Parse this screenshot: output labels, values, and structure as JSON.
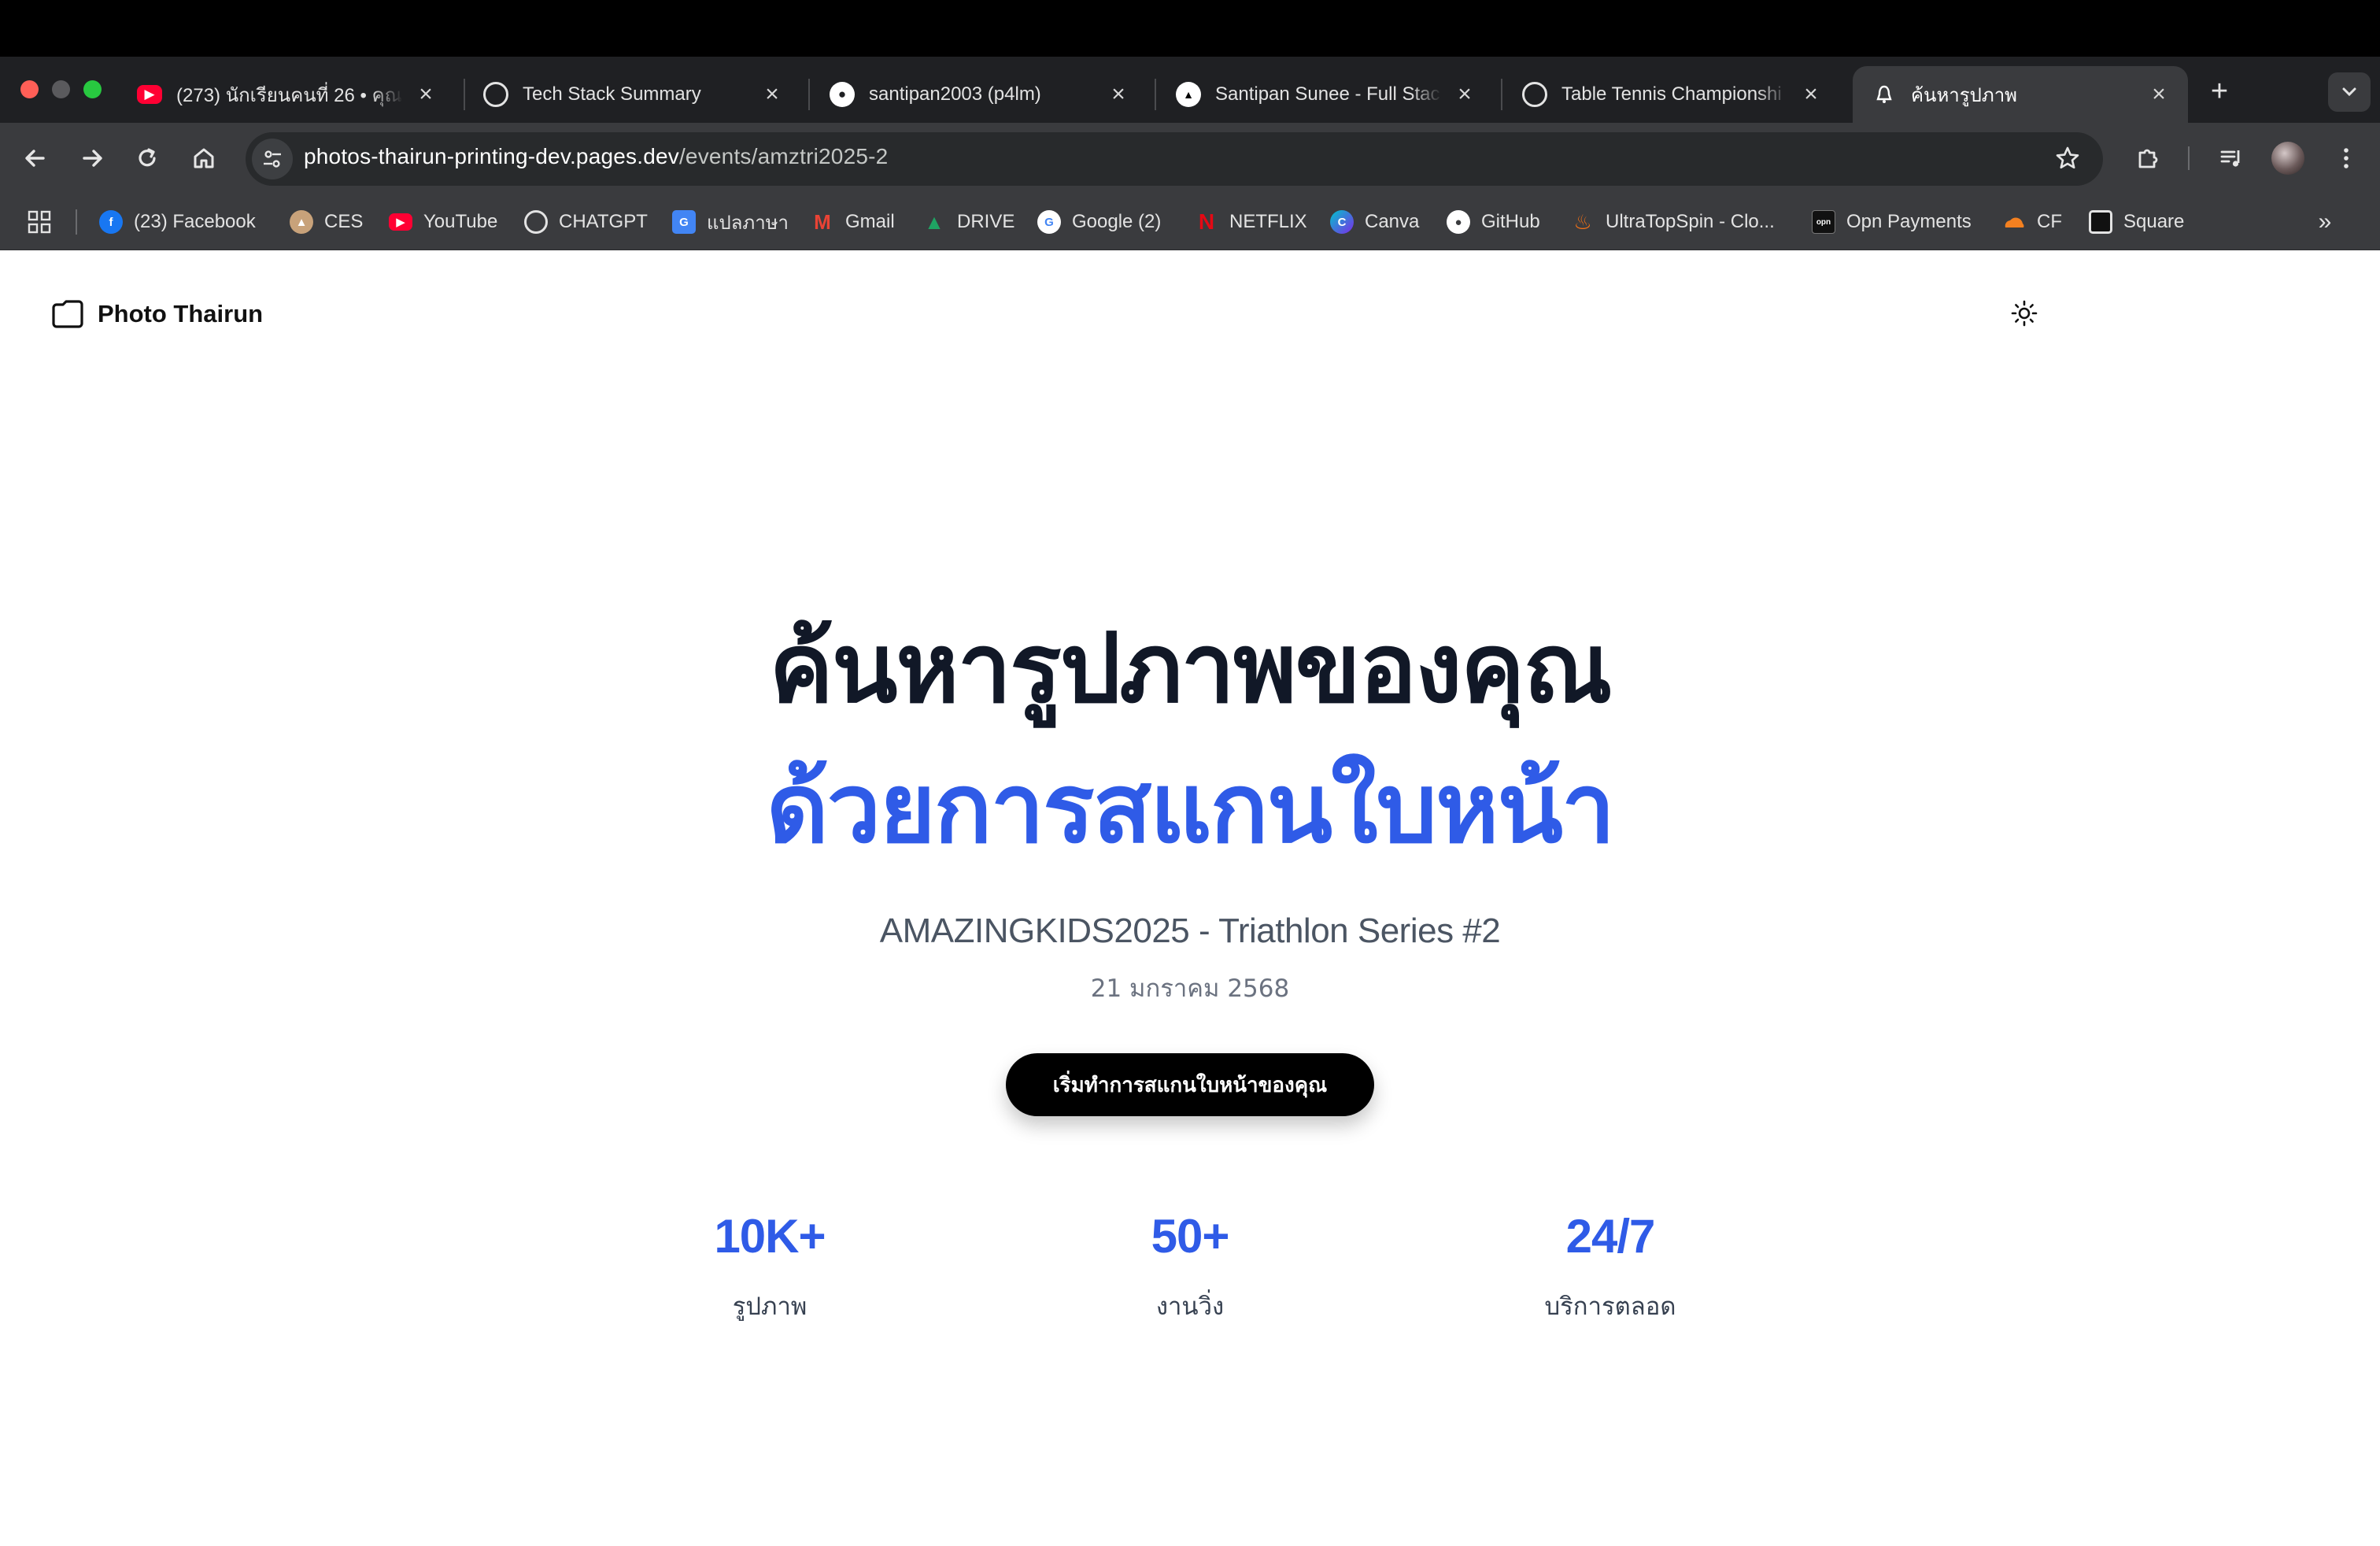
{
  "browser": {
    "tabs": [
      {
        "title": "(273) นักเรียนคนที่ 26 • คุณ",
        "icon": "youtube-icon",
        "color": "#ff0033",
        "active": false
      },
      {
        "title": "Tech Stack Summary",
        "icon": "openai-icon",
        "color": "#ffffff",
        "active": false
      },
      {
        "title": "santipan2003 (p4lm)",
        "icon": "github-icon",
        "color": "#ffffff",
        "active": false
      },
      {
        "title": "Santipan Sunee - Full Stac",
        "icon": "vercel-icon",
        "color": "#ffffff",
        "active": false
      },
      {
        "title": "Table Tennis Championshi",
        "icon": "swirl-icon",
        "color": "#ffffff",
        "active": false
      },
      {
        "title": "ค้นหารูปภาพ",
        "icon": "app-icon",
        "color": "#ffffff",
        "active": true
      }
    ],
    "url": {
      "host": "photos-thairun-printing-dev.pages.dev",
      "path": "/events/amztri2025-2"
    },
    "bookmarks": [
      {
        "label": "(23) Facebook",
        "icon": "facebook-icon",
        "color": "#1877f2"
      },
      {
        "label": "CES",
        "icon": "ces-icon",
        "color": "#c8a27a"
      },
      {
        "label": "YouTube",
        "icon": "youtube-icon",
        "color": "#ff0033"
      },
      {
        "label": "CHATGPT",
        "icon": "openai-icon",
        "color": "#3a3b3e"
      },
      {
        "label": "แปลภาษา",
        "icon": "translate-icon",
        "color": "#4285f4"
      },
      {
        "label": "Gmail",
        "icon": "gmail-icon",
        "color": "#ea4335"
      },
      {
        "label": "DRIVE",
        "icon": "drive-icon",
        "color": "#1fa463"
      },
      {
        "label": "Google (2)",
        "icon": "google-icon",
        "color": "#ffffff"
      },
      {
        "label": "NETFLIX",
        "icon": "netflix-icon",
        "color": "#e50914"
      },
      {
        "label": "Canva",
        "icon": "canva-icon",
        "color": "#00c4cc"
      },
      {
        "label": "GitHub",
        "icon": "github-icon",
        "color": "#3a3b3e"
      },
      {
        "label": "UltraTopSpin - Clo...",
        "icon": "flame-icon",
        "color": "#f97316"
      },
      {
        "label": "Opn Payments",
        "icon": "opn-icon",
        "color": "#111111"
      },
      {
        "label": "CF",
        "icon": "cloudflare-icon",
        "color": "#f38020"
      },
      {
        "label": "Square",
        "icon": "square-icon",
        "color": "#111111"
      }
    ]
  },
  "site": {
    "brand": "Photo Thairun"
  },
  "hero": {
    "line1": "ค้นหารูปภาพของคุณ",
    "line2": "ด้วยการสแกนใบหน้า",
    "event_name": "AMAZINGKIDS2025 - Triathlon Series #2",
    "event_date": "21 มกราคม 2568",
    "cta": "เริ่มทำการสแกนใบหน้าของคุณ"
  },
  "stats": [
    {
      "value": "10K+",
      "label": "รูปภาพ"
    },
    {
      "value": "50+",
      "label": "งานวิ่ง"
    },
    {
      "value": "24/7",
      "label": "บริการตลอด"
    }
  ],
  "colors": {
    "accent": "#2f5be7",
    "heading": "#111827",
    "cta_bg": "#000000"
  }
}
